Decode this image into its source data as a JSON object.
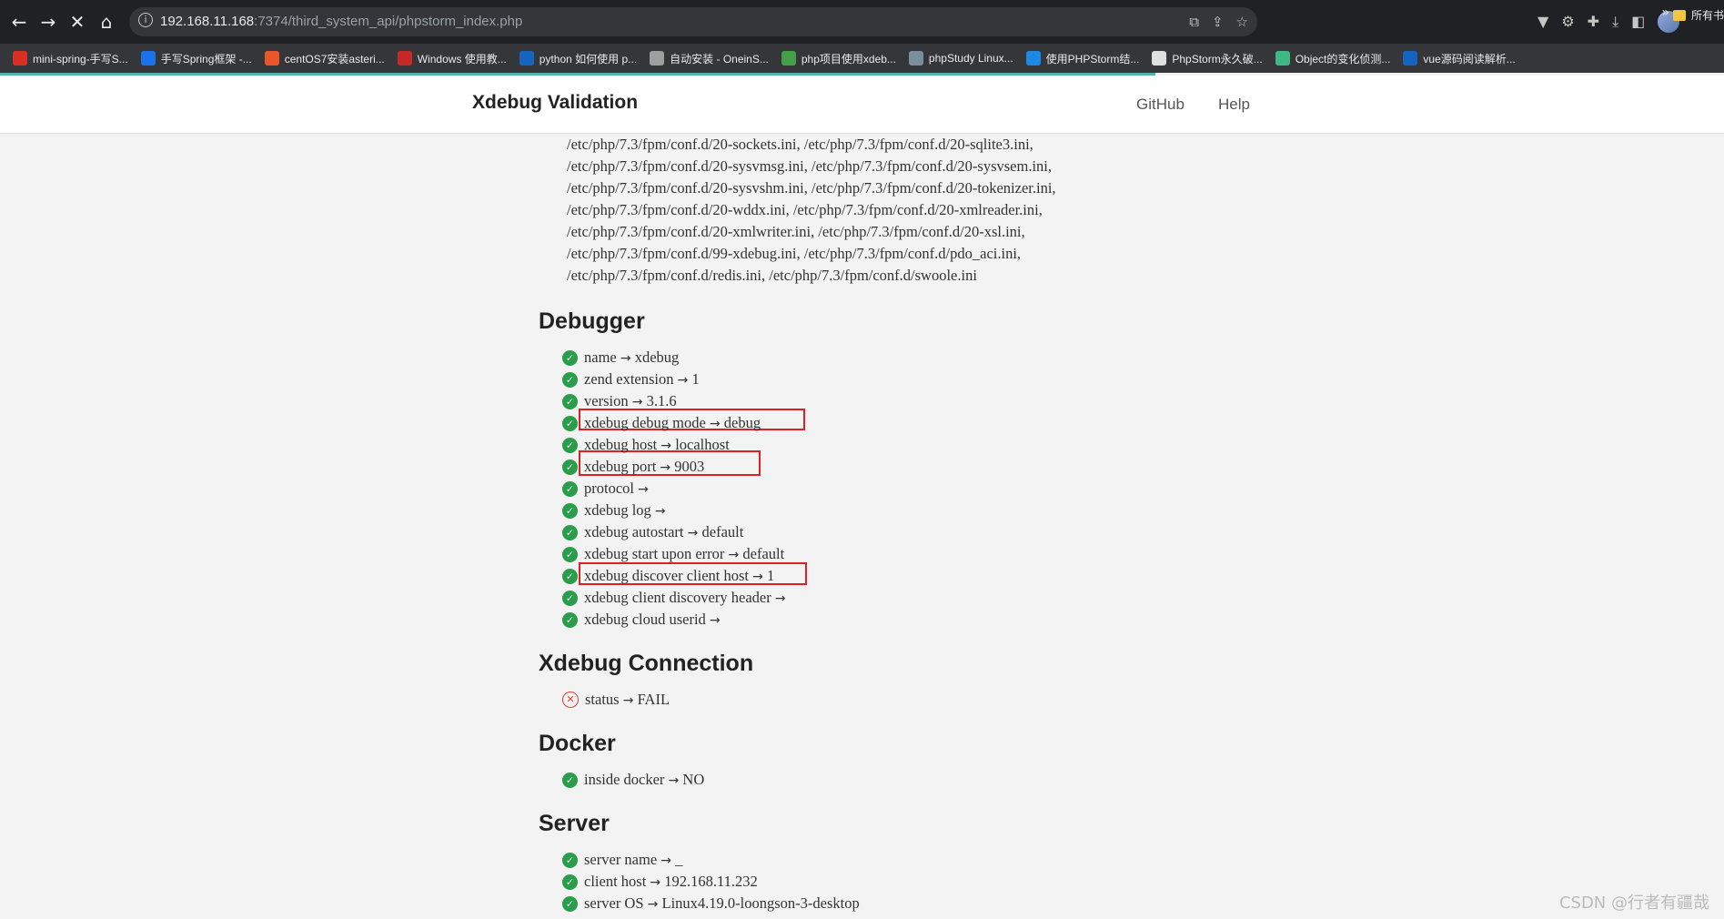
{
  "browser": {
    "url_host": "192.168.11.168",
    "url_rest": ":7374/third_system_api/phpstorm_index.php",
    "bookmarks": [
      {
        "label": "mini-spring-手写S...",
        "color": "#d93025"
      },
      {
        "label": "手写Spring框架 -...",
        "color": "#1a73e8"
      },
      {
        "label": "centOS7安装asteri...",
        "color": "#e8562a"
      },
      {
        "label": "Windows 使用教...",
        "color": "#c62828"
      },
      {
        "label": "python 如何使用 p...",
        "color": "#1565c0"
      },
      {
        "label": "自动安装 - OneinS...",
        "color": "#9e9e9e"
      },
      {
        "label": "php项目使用xdeb...",
        "color": "#43a047"
      },
      {
        "label": "phpStudy Linux...",
        "color": "#78909c"
      },
      {
        "label": "使用PHPStorm结...",
        "color": "#1e88e5"
      },
      {
        "label": "PhpStorm永久破...",
        "color": "#e0e0e0"
      },
      {
        "label": "Object的变化侦测...",
        "color": "#41b883"
      },
      {
        "label": "vue源码阅读解析...",
        "color": "#1565c0"
      }
    ],
    "more": "»",
    "folder": "所有书"
  },
  "header": {
    "title": "Xdebug Validation",
    "github": "GitHub",
    "help": "Help"
  },
  "ini_lines": [
    "/etc/php/7.3/fpm/conf.d/20-sockets.ini, /etc/php/7.3/fpm/conf.d/20-sqlite3.ini,",
    "/etc/php/7.3/fpm/conf.d/20-sysvmsg.ini, /etc/php/7.3/fpm/conf.d/20-sysvsem.ini,",
    "/etc/php/7.3/fpm/conf.d/20-sysvshm.ini, /etc/php/7.3/fpm/conf.d/20-tokenizer.ini,",
    "/etc/php/7.3/fpm/conf.d/20-wddx.ini, /etc/php/7.3/fpm/conf.d/20-xmlreader.ini,",
    "/etc/php/7.3/fpm/conf.d/20-xmlwriter.ini, /etc/php/7.3/fpm/conf.d/20-xsl.ini,",
    "/etc/php/7.3/fpm/conf.d/99-xdebug.ini, /etc/php/7.3/fpm/conf.d/pdo_aci.ini,",
    "/etc/php/7.3/fpm/conf.d/redis.ini, /etc/php/7.3/fpm/conf.d/swoole.ini"
  ],
  "debugger": {
    "title": "Debugger",
    "items": [
      {
        "key": "name",
        "value": "xdebug"
      },
      {
        "key": "zend extension",
        "value": "1"
      },
      {
        "key": "version",
        "value": "3.1.6"
      },
      {
        "key": "xdebug debug mode",
        "value": "debug"
      },
      {
        "key": "xdebug host",
        "value": "localhost"
      },
      {
        "key": "xdebug port",
        "value": "9003"
      },
      {
        "key": "protocol",
        "value": ""
      },
      {
        "key": "xdebug log",
        "value": ""
      },
      {
        "key": "xdebug autostart",
        "value": "default"
      },
      {
        "key": "xdebug start upon error",
        "value": "default"
      },
      {
        "key": "xdebug discover client host",
        "value": "1"
      },
      {
        "key": "xdebug client discovery header",
        "value": ""
      },
      {
        "key": "xdebug cloud userid",
        "value": ""
      }
    ]
  },
  "connection": {
    "title": "Xdebug Connection",
    "items": [
      {
        "key": "status",
        "value": "FAIL"
      }
    ]
  },
  "docker": {
    "title": "Docker",
    "items": [
      {
        "key": "inside docker",
        "value": "NO"
      }
    ]
  },
  "server": {
    "title": "Server",
    "items": [
      {
        "key": "server name",
        "value": "_"
      },
      {
        "key": "client host",
        "value": "192.168.11.232"
      },
      {
        "key": "server OS",
        "value": "Linux4.19.0-loongson-3-desktop"
      }
    ]
  },
  "arrow": "→",
  "watermark": "CSDN @行者有疆哉"
}
